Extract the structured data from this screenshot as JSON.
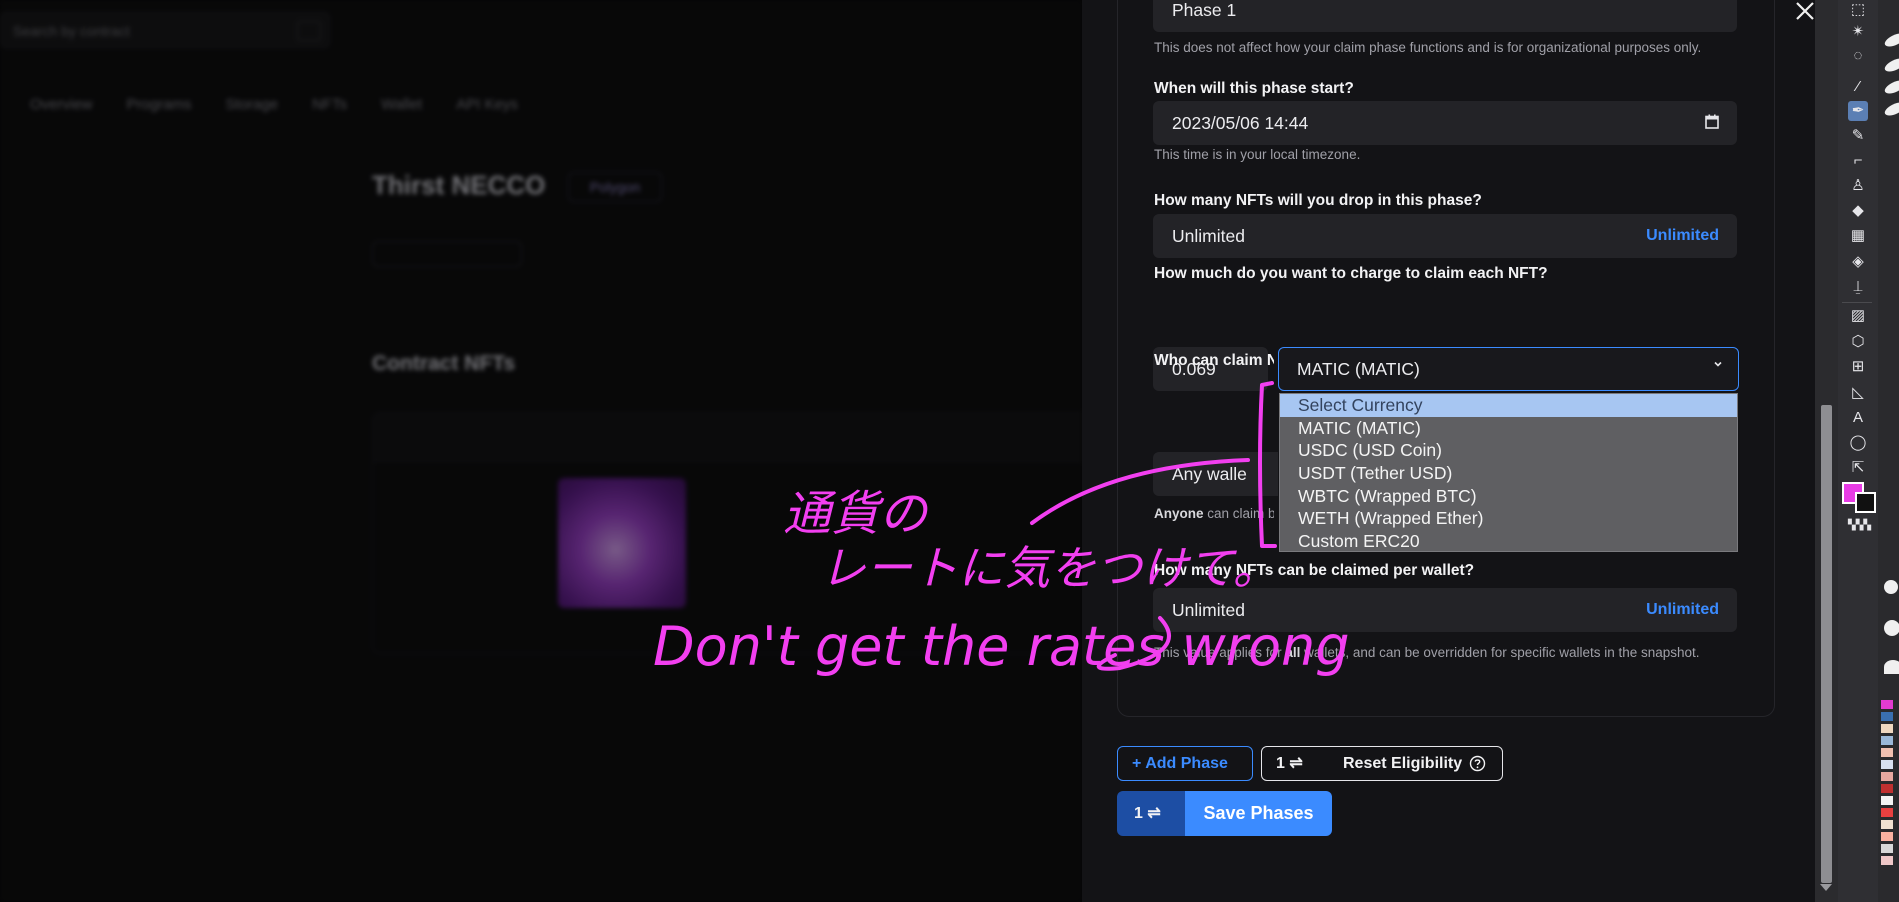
{
  "background": {
    "search_placeholder": "Search by contract",
    "tabs": [
      "Overview",
      "Programs",
      "Storage",
      "NFTs",
      "Wallet",
      "API Keys"
    ],
    "project_title": "Thirst NECCO",
    "chain_badge": "Polygon",
    "section_heading": "Contract NFTs"
  },
  "drawer": {
    "phase_name_value": "Phase 1",
    "phase_name_help": "This does not affect how your claim phase functions and is for organizational purposes only.",
    "start_label": "When will this phase start?",
    "start_value": "2023/05/06 14:44",
    "start_help": "This time is in your local timezone.",
    "drop_label": "How many NFTs will you drop in this phase?",
    "drop_value": "Unlimited",
    "drop_link": "Unlimited",
    "price_label": "How much do you want to charge to claim each NFT?",
    "price_value": "0.069",
    "currency_selected": "MATIC (MATIC)",
    "who_label": "Who can claim N",
    "who_value": "Any walle",
    "who_help_bold": "Anyone",
    "who_help_rest": " can claim b",
    "per_wallet_label": "How many NFTs can be claimed per wallet?",
    "per_wallet_value": "Unlimited",
    "per_wallet_link": "Unlimited",
    "per_wallet_help_pre": "This value applies for ",
    "per_wallet_help_bold": "all",
    "per_wallet_help_post": " wallets, and can be overridden for specific wallets in the snapshot.",
    "add_phase": "+ Add Phase",
    "reset_count": "1 ⇌",
    "reset_label": "Reset Eligibility",
    "save_count": "1 ⇌",
    "save_label": "Save Phases"
  },
  "currency_options": [
    "Select Currency",
    "MATIC (MATIC)",
    "USDC (USD Coin)",
    "USDT (Tether USD)",
    "WBTC (Wrapped BTC)",
    "WETH (Wrapped Ether)",
    "Custom ERC20"
  ],
  "annotation": {
    "line1": "通貨の",
    "line2": "レートに気をつけて。",
    "line3": "Don't get the rates wrong",
    "color": "#f23ff0"
  },
  "colors": {
    "accent": "#3b8bff",
    "drawer_bg": "#131316",
    "field_bg": "#232327"
  }
}
